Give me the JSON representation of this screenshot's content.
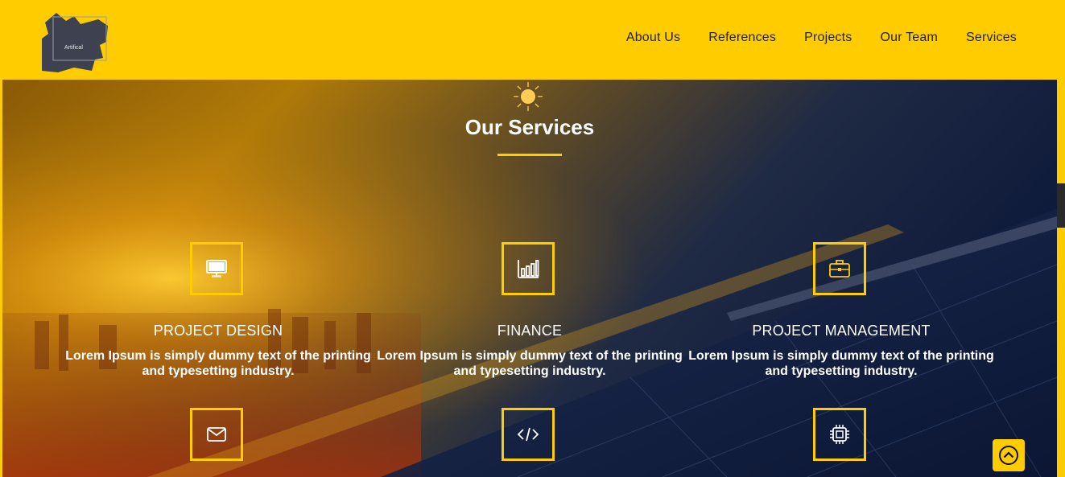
{
  "brand": {
    "logo_text": "Artifical"
  },
  "nav": {
    "items": [
      {
        "label": "About Us"
      },
      {
        "label": "References"
      },
      {
        "label": "Projects"
      },
      {
        "label": "Our Team"
      },
      {
        "label": "Services"
      }
    ]
  },
  "section": {
    "title": "Our Services"
  },
  "services": [
    {
      "title": "PROJECT DESIGN",
      "description": "Lorem Ipsum is simply dummy text of the printing and typesetting industry.",
      "icon": "monitor-icon"
    },
    {
      "title": "FINANCE",
      "description": "Lorem Ipsum is simply dummy text of the printing and typesetting industry.",
      "icon": "bar-chart-icon"
    },
    {
      "title": "PROJECT MANAGEMENT",
      "description": "Lorem Ipsum is simply dummy text of the printing and typesetting industry.",
      "icon": "briefcase-icon"
    },
    {
      "icon": "envelope-icon"
    },
    {
      "icon": "code-icon"
    },
    {
      "icon": "chip-icon"
    }
  ],
  "colors": {
    "accent": "#ffcc00",
    "text_dark": "#222222",
    "text_light": "#ffffff",
    "logo_dark": "#3d4150"
  }
}
